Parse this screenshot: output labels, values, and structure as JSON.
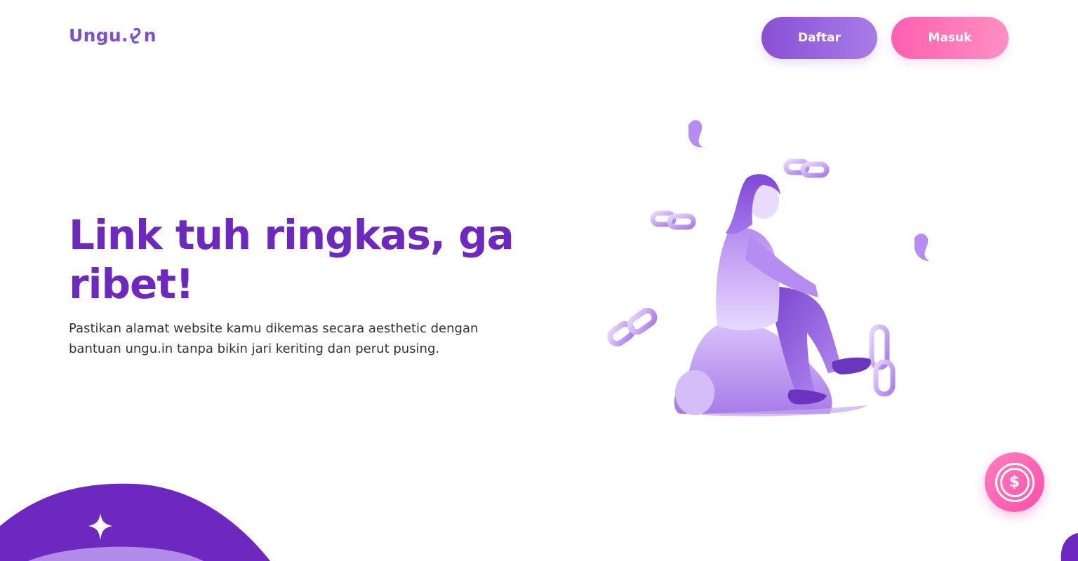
{
  "brand": {
    "logo_text": "Ungu.",
    "logo_suffix": "n"
  },
  "nav": {
    "daftar_label": "Daftar",
    "masuk_label": "Masuk"
  },
  "hero": {
    "title": "Link tuh ringkas, ga ribet!",
    "description": "Pastikan alamat website kamu dikemas secara aesthetic dengan bantuan ungu.in tanpa bikin jari keriting dan perut pusing."
  },
  "fab": {
    "symbol": "$",
    "icon": "dollar-coin-icon"
  },
  "colors": {
    "primary": "#6d28c0",
    "logo": "#7b4fd0",
    "daftar_gradient": [
      "#8a4fd6",
      "#a77ce6"
    ],
    "masuk_gradient": [
      "#ff5faf",
      "#ff8fc3"
    ],
    "text": "#333333"
  }
}
